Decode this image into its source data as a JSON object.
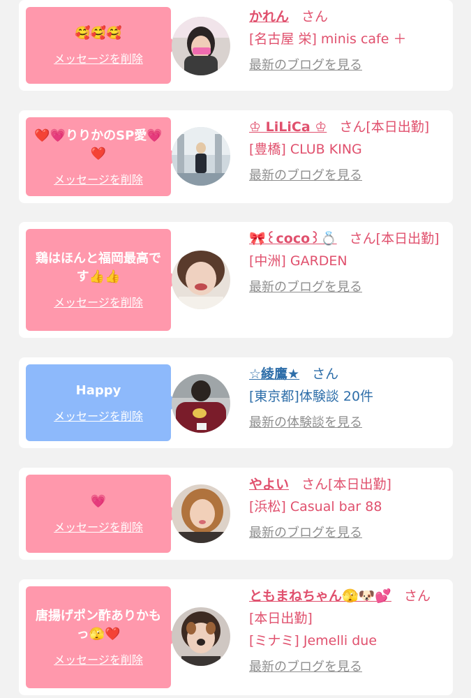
{
  "items": [
    {
      "message": "🥰🥰🥰",
      "delete_label": "メッセージを削除",
      "name": "かれん",
      "suffix": "さん",
      "status": "",
      "store": "[名古屋 栄] minis cafe ＋",
      "link": "最新のブログを見る",
      "theme": "pink"
    },
    {
      "message": "❤️💗りりかのSP愛💗❤️",
      "delete_label": "メッセージを削除",
      "name": "♔ LiLiCa ♔",
      "suffix": "さん",
      "status": "[本日出勤]",
      "store": "[豊橋] CLUB KING",
      "link": "最新のブログを見る",
      "theme": "pink"
    },
    {
      "message": "鶏はほんと福岡最高です👍👍",
      "delete_label": "メッセージを削除",
      "name": "🎀꒰coco꒱💍",
      "suffix": "さん",
      "status": "[本日出勤]",
      "store": "[中洲] GARDEN",
      "link": "最新のブログを見る",
      "theme": "pink"
    },
    {
      "message": "Happy",
      "delete_label": "メッセージを削除",
      "name": "☆綾鷹★",
      "suffix": "さん",
      "status": "",
      "store": "[東京都]体験談 20件",
      "link": "最新の体験談を見る",
      "theme": "blue"
    },
    {
      "message": "💗",
      "delete_label": "メッセージを削除",
      "name": "やよい",
      "suffix": "さん",
      "status": "[本日出勤]",
      "store": "[浜松] Casual bar 88",
      "link": "最新のブログを見る",
      "theme": "pink"
    },
    {
      "message": "唐揚げポン酢ありかもっ🫣❤️",
      "delete_label": "メッセージを削除",
      "name": "ともまねちゃん🫣🐶💕",
      "suffix": "さん",
      "status": "[本日出勤]",
      "store": "[ミナミ] Jemelli due",
      "link": "最新のブログを見る",
      "theme": "pink"
    }
  ],
  "colors": {
    "pink_bubble": "#ff98ac",
    "blue_bubble": "#8db9fb",
    "pink_text": "#e0506d",
    "blue_text": "#2e6ea9",
    "link_gray": "#8e8e8e"
  }
}
